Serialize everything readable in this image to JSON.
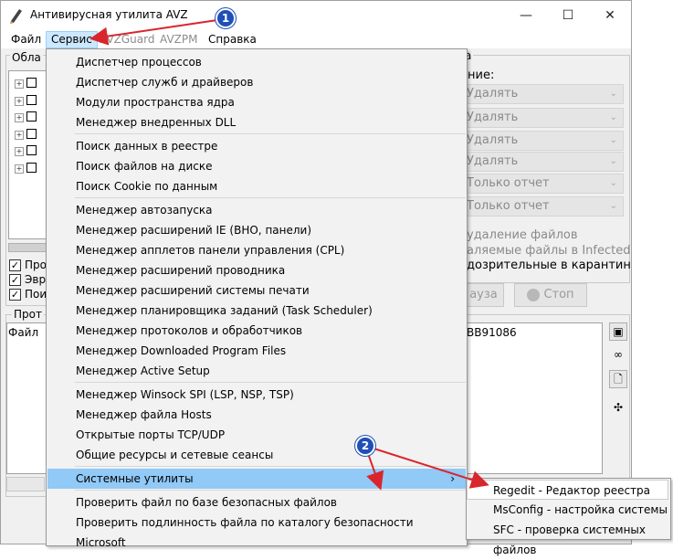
{
  "window": {
    "title": "Антивирусная утилита AVZ",
    "caption_buttons": {
      "minimize": "—",
      "maximize": "☐",
      "close": "✕"
    }
  },
  "menubar": {
    "items": [
      {
        "label": "Файл",
        "enabled": true
      },
      {
        "label": "Сервис",
        "enabled": true,
        "active": true
      },
      {
        "label": "AVZGuard",
        "enabled": false
      },
      {
        "label": "AVZPM",
        "enabled": false
      },
      {
        "label": "Справка",
        "enabled": true
      }
    ]
  },
  "background": {
    "left_group_label": "Обла",
    "right_group_label": "а",
    "action_label": "ние:",
    "combos": [
      "Удалять",
      "Удалять",
      "Удалять",
      "Удалять",
      "Только отчет",
      "Только отчет"
    ],
    "options": [
      "Про",
      "Эвр",
      "Пои"
    ],
    "checks_text": [
      "удаление файлов",
      "аляемые файлы в  Infected",
      "дозрительные в  карантин"
    ],
    "pause_label": "ауза",
    "stop_label": "Стоп",
    "protocol_label": "Прот",
    "file_label": "Файл",
    "log_text": "BB91086"
  },
  "dropdown": {
    "groups": [
      [
        "Диспетчер процессов",
        "Диспетчер служб и драйверов",
        "Модули пространства ядра",
        "Менеджер внедренных DLL"
      ],
      [
        "Поиск данных  в реестре",
        "Поиск файлов на диске",
        "Поиск Cookie по данным"
      ],
      [
        "Менеджер автозапуска",
        "Менеджер расширений IE (BHO, панели)",
        "Менеджер апплетов панели управления (CPL)",
        "Менеджер расширений проводника",
        "Менеджер расширений системы печати",
        "Менеджер планировщика заданий (Task Scheduler)",
        "Менеджер протоколов и обработчиков",
        "Менеджер Downloaded Program Files",
        "Менеджер Active Setup"
      ],
      [
        "Менеджер Winsock SPI (LSP, NSP, TSP)",
        "Менеджер файла Hosts",
        "Открытые порты TCP/UDP",
        "Общие ресурсы и сетевые сеансы"
      ],
      [
        "Системные утилиты"
      ],
      [
        "Проверить файл по базе безопасных файлов",
        "Проверить подлинность файла по каталогу безопасности Microsoft"
      ]
    ],
    "submenu_arrow": "›"
  },
  "submenu": {
    "items": [
      "Regedit - Редактор реестра",
      "MsConfig - настройка системы",
      "SFC - проверка системных файлов"
    ]
  },
  "annotations": {
    "badge1": "1",
    "badge2": "2",
    "arrow_color": "#d9262c",
    "badge_color": "#1f4fb8"
  }
}
